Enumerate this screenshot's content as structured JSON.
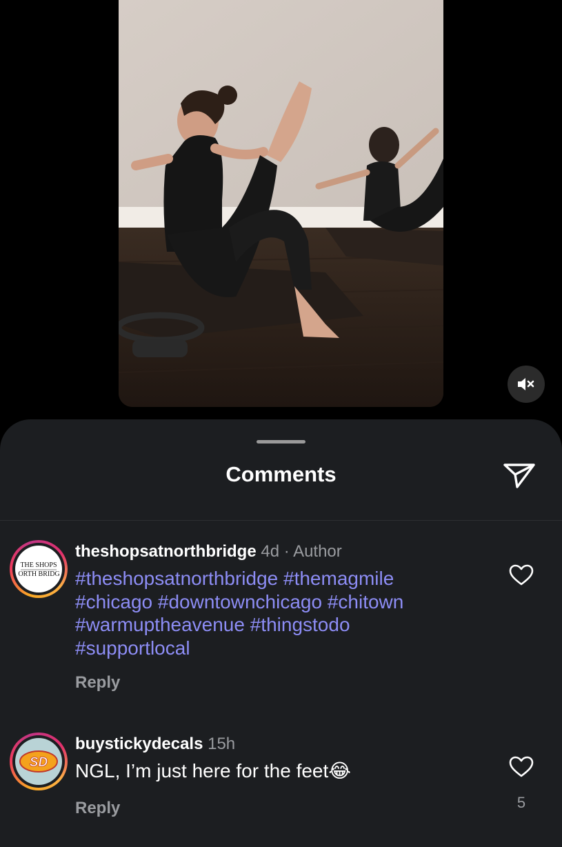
{
  "sheet": {
    "title": "Comments"
  },
  "comments": [
    {
      "username": "theshopsatnorthbridge",
      "time": "4d",
      "separator": "·",
      "badge": "Author",
      "avatar_logo": "THE SHOPS AT NORTH BRIDGE",
      "hashtags": [
        "#theshopsatnorthbridge",
        "#themagmile",
        "#chicago",
        "#downtownchicago",
        "#chitown",
        "#warmuptheavenue",
        "#thingstodo",
        "#supportlocal"
      ],
      "reply_label": "Reply",
      "like_icon": "heart-outline-icon"
    },
    {
      "username": "buystickydecals",
      "time": "15h",
      "avatar_logo": "SD",
      "text": "NGL, I’m just here for the feet",
      "emoji": "😂",
      "reply_label": "Reply",
      "like_icon": "heart-outline-icon",
      "like_count": "5"
    }
  ],
  "icons": {
    "mute": "speaker-muted-icon",
    "share": "paper-plane-icon"
  },
  "colors": {
    "sheet_bg": "#1c1e21",
    "hashtag": "#8d8df5",
    "muted_text": "#9a9ca0"
  }
}
